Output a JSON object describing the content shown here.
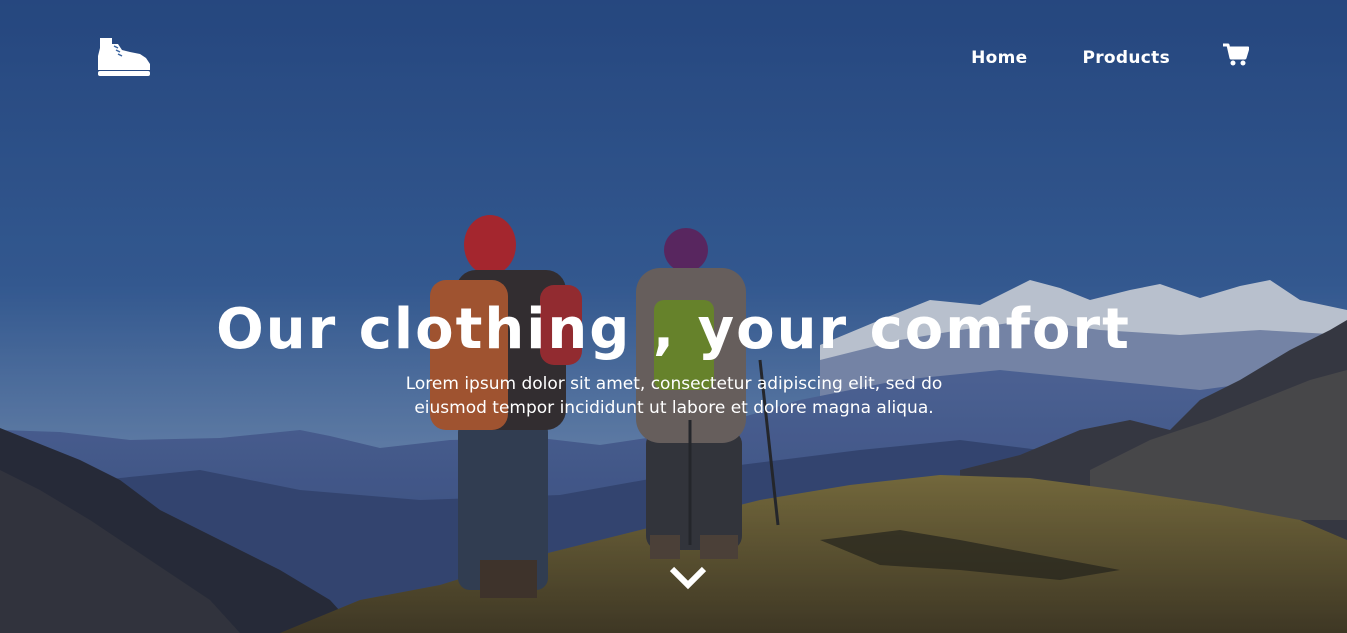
{
  "brand": {
    "logo_icon": "hiking-boot-icon"
  },
  "nav": {
    "home_label": "Home",
    "products_label": "Products",
    "cart_icon": "shopping-cart-icon"
  },
  "hero": {
    "headline": "Our clothing , your comfort",
    "subtext": "Lorem ipsum dolor sit amet, consectetur adipiscing elit, sed do eiusmod tempor incididunt ut labore et dolore magna aliqua.",
    "scroll_icon": "chevron-down-icon",
    "background_scene": "two hikers on mountain ridge overlooking snowy peaks"
  },
  "colors": {
    "text": "#ffffff",
    "sky": "#2f5590"
  }
}
